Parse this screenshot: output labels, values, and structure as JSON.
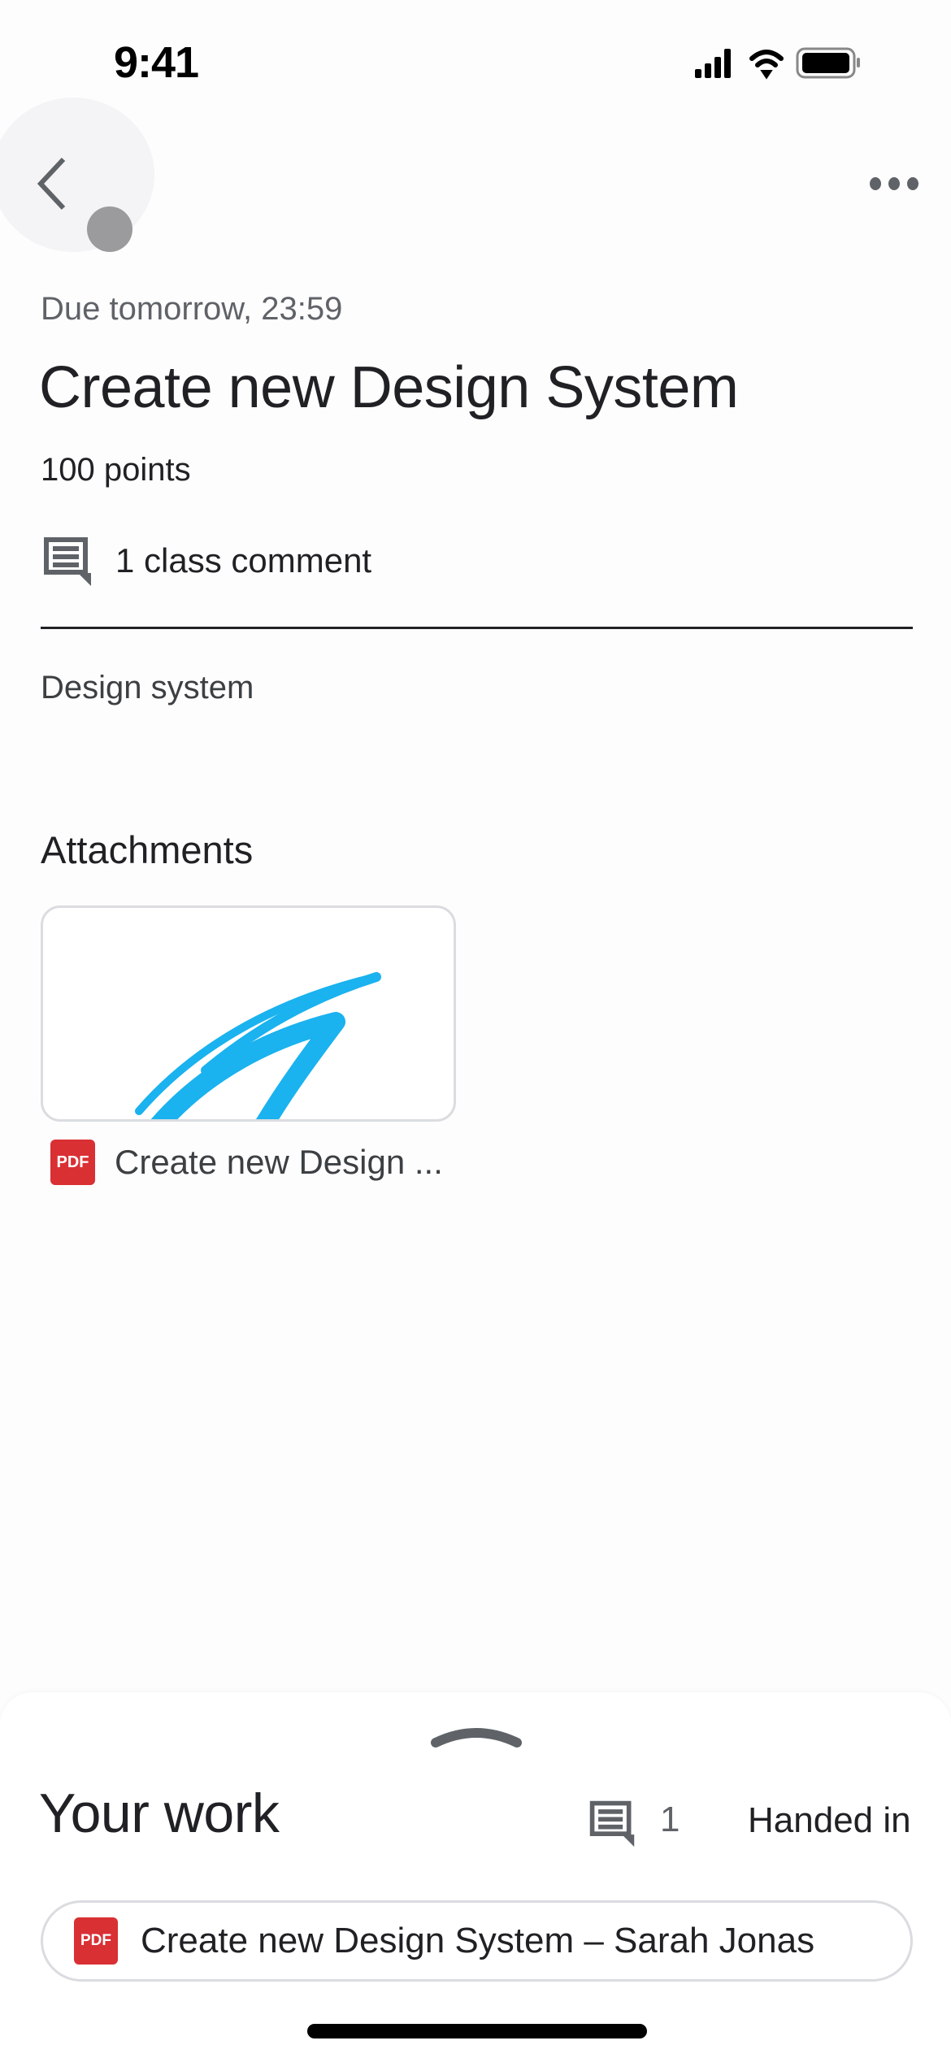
{
  "status_bar": {
    "time": "9:41",
    "icons": [
      "cellular-signal-icon",
      "wifi-icon",
      "battery-icon"
    ]
  },
  "header": {
    "back_icon": "chevron-left-icon",
    "more_icon": "more-horizontal-icon"
  },
  "assignment": {
    "due": "Due tomorrow, 23:59",
    "title": "Create new Design System",
    "points": "100 points",
    "class_comments": "1 class comment",
    "description": "Design system"
  },
  "attachments": {
    "heading": "Attachments",
    "items": [
      {
        "type_badge": "PDF",
        "name": "Create new Design ..."
      }
    ],
    "colors": {
      "pdf_red": "#d93034",
      "thumbnail_stroke": "#1ab2ef"
    }
  },
  "your_work": {
    "heading": "Your work",
    "comment_count": "1",
    "status": "Handed in",
    "file": {
      "type_badge": "PDF",
      "name": "Create new Design System – Sarah Jonas"
    }
  }
}
